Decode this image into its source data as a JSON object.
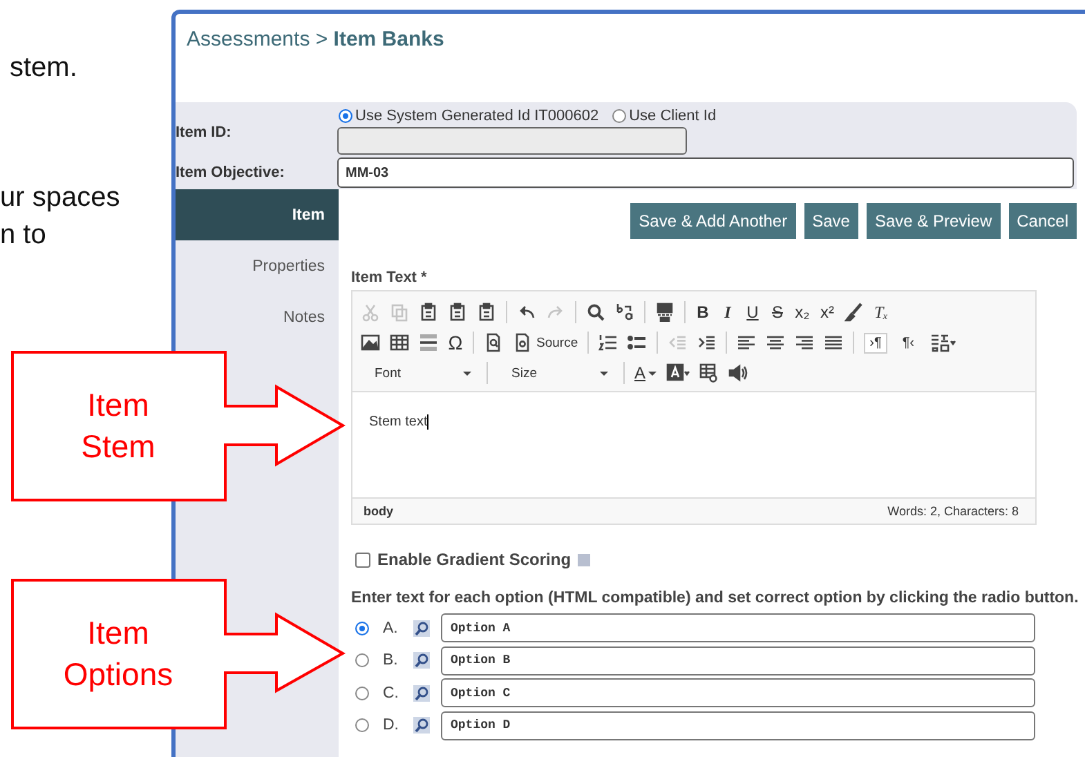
{
  "slide_text": [
    "stem.",
    "ur spaces",
    "n to"
  ],
  "breadcrumb": {
    "parent": "Assessments",
    "separator": ">",
    "current": "Item Banks"
  },
  "item_id": {
    "label": "Item ID:",
    "options": [
      {
        "label": "Use System Generated Id IT000602",
        "selected": true
      },
      {
        "label": "Use Client Id",
        "selected": false
      }
    ]
  },
  "item_objective": {
    "label": "Item Objective:",
    "value": "MM-03"
  },
  "nav": [
    {
      "label": "Item",
      "selected": true
    },
    {
      "label": "Properties",
      "selected": false
    },
    {
      "label": "Notes",
      "selected": false
    }
  ],
  "buttons": [
    "Save & Add Another",
    "Save",
    "Save & Preview",
    "Cancel"
  ],
  "editor": {
    "label": "Item Text *",
    "format_glyphs": [
      "B",
      "I",
      "U",
      "S",
      "x₂",
      "x²"
    ],
    "clear_format": "Tₓ",
    "special_char": "Ω",
    "source_label": "Source",
    "direction_glyphs": [
      "›¶",
      "¶‹"
    ],
    "font": "Font",
    "size": "Size",
    "text_color": "A",
    "content": "Stem text",
    "path": "body",
    "counts": "Words: 2, Characters: 8"
  },
  "gradient_scoring": {
    "label": "Enable Gradient Scoring",
    "checked": false
  },
  "options_instruction": "Enter text for each option (HTML compatible) and set correct option by clicking the radio button.",
  "options": [
    {
      "letter": "A.",
      "value": "Option A",
      "selected": true
    },
    {
      "letter": "B.",
      "value": "Option B",
      "selected": false
    },
    {
      "letter": "C.",
      "value": "Option C",
      "selected": false
    },
    {
      "letter": "D.",
      "value": "Option D",
      "selected": false
    }
  ],
  "callouts": [
    {
      "text": "Item Stem"
    },
    {
      "text": "Item Options"
    }
  ]
}
